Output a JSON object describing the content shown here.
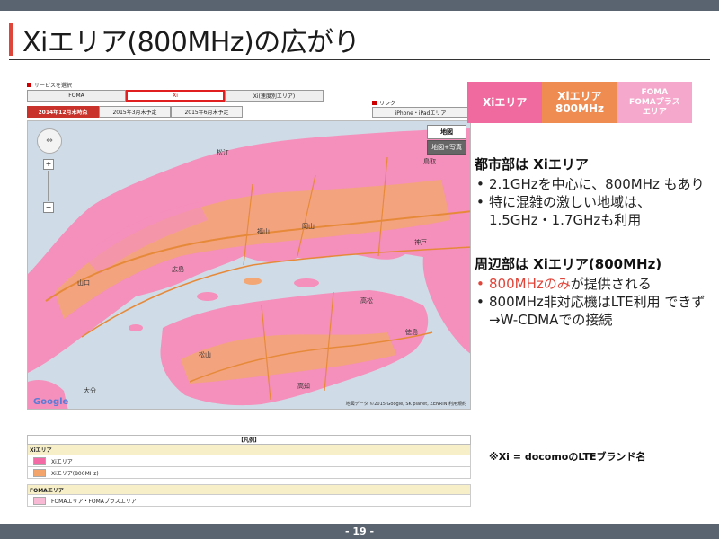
{
  "slide": {
    "title": "Xiエリア(800MHz)の広がり",
    "page_number": "- 19 -"
  },
  "map_panel": {
    "service_header": "サービスを選択",
    "service_tabs": [
      "FOMA",
      "Xi",
      "Xi(速度別エリア)"
    ],
    "active_service": "Xi",
    "date_tabs": [
      "2014年12月末時点",
      "2015年3月末予定",
      "2015年6月末予定"
    ],
    "active_date": "2014年12月末時点",
    "link_header": "リンク",
    "link_button": "iPhone・iPadエリア",
    "map_type_map": "地図",
    "map_type_satellite": "地図+写真",
    "google_logo": "Google",
    "copyright": "地図データ ©2015 Google, SK planet, ZENRIN 利用規約",
    "place_labels": [
      "鳥取",
      "岡山",
      "広島",
      "松江",
      "高松",
      "松山",
      "神戸",
      "徳島",
      "福山",
      "高知",
      "山口",
      "大分"
    ],
    "legend": {
      "title": "【凡例】",
      "sections": [
        {
          "name": "Xiエリア",
          "rows": [
            {
              "label": "Xiエリア",
              "color": "#f36aa5"
            },
            {
              "label": "Xiエリア(800MHz)",
              "color": "#f2a46b"
            }
          ]
        },
        {
          "name": "FOMAエリア",
          "rows": [
            {
              "label": "FOMAエリア・FOMAプラスエリア",
              "color": "#f7b9d3"
            }
          ]
        }
      ]
    }
  },
  "area_tabs": [
    {
      "line1": "Xiエリア",
      "line2": ""
    },
    {
      "line1": "Xiエリア",
      "line2": "800MHz"
    },
    {
      "line1": "FOMA",
      "line2": "FOMAプラス",
      "line3": "エリア"
    }
  ],
  "bullets": {
    "section1_heading": "都市部は Xiエリア",
    "section1_items": [
      "2.1GHzを中心に、800MHz もあり",
      "特に混雑の激しい地域は、 1.5GHz・1.7GHzも利用"
    ],
    "section2_heading": "周辺部は Xiエリア(800MHz)",
    "section2_items": [
      {
        "red": "800MHzのみ",
        "rest": "が提供される"
      },
      {
        "text": "800MHz非対応機はLTE利用 できず"
      },
      {
        "text": "→W-CDMAでの接続"
      }
    ],
    "bullet_glyph": "•"
  },
  "note": "※Xi = docomoのLTEブランド名",
  "colors": {
    "accent_red": "#e0453a",
    "xi_pink": "#f06aa0",
    "xi800_orange": "#ef8c52",
    "foma_light_pink": "#f5a8cb",
    "header_gray": "#5a6470"
  }
}
